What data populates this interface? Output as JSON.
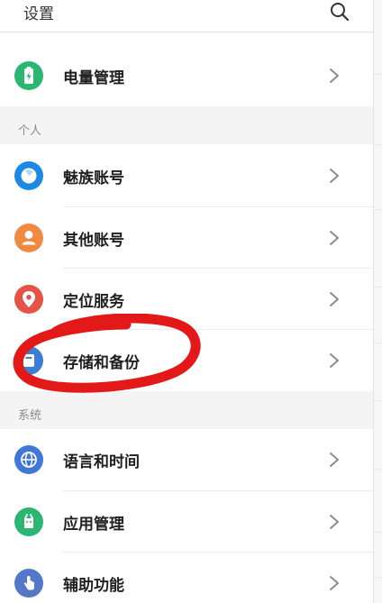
{
  "header": {
    "title": "设置",
    "search_icon": "search-icon"
  },
  "rows": [
    {
      "label": "电量管理",
      "icon": "battery-icon",
      "color": "#2bb673"
    },
    {
      "label": "魅族账号",
      "icon": "meizu-account-icon",
      "color": "#1e88e5"
    },
    {
      "label": "其他账号",
      "icon": "person-icon",
      "color": "#f08a40"
    },
    {
      "label": "定位服务",
      "icon": "location-pin-icon",
      "color": "#e55347"
    },
    {
      "label": "存储和备份",
      "icon": "storage-icon",
      "color": "#3d7dd6"
    },
    {
      "label": "语言和时间",
      "icon": "globe-icon",
      "color": "#3f78d8"
    },
    {
      "label": "应用管理",
      "icon": "app-manager-icon",
      "color": "#2bb673"
    },
    {
      "label": "辅助功能",
      "icon": "hand-icon",
      "color": "#5477c8"
    }
  ],
  "sections": {
    "personal": "个人",
    "system": "系统"
  },
  "annotation": {
    "type": "hand-drawn-circle",
    "color": "#e31919",
    "target": "存储和备份"
  }
}
